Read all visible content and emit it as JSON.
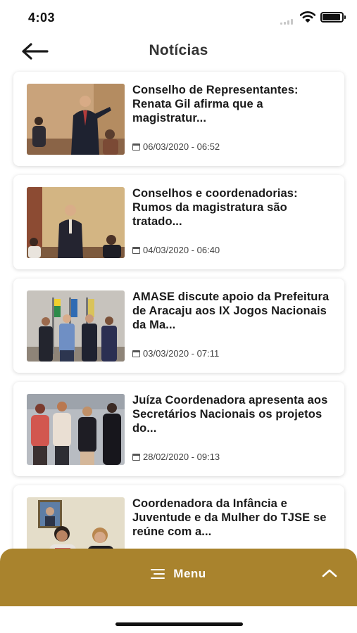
{
  "status_bar": {
    "time": "4:03"
  },
  "header": {
    "title": "Notícias",
    "back_icon": "arrow-left-icon"
  },
  "news": [
    {
      "title": "Conselho de Representantes: Renata Gil afirma que a magistratur...",
      "date": "06/03/2020 - 06:52"
    },
    {
      "title": "Conselhos e coordenadorias: Rumos da magistratura são tratado...",
      "date": "04/03/2020 - 06:40"
    },
    {
      "title": "AMASE  discute apoio da Prefeitura de Aracaju aos IX Jogos Nacionais da Ma...",
      "date": "03/03/2020 - 07:11"
    },
    {
      "title": "Juíza Coordenadora apresenta aos Secretários Nacionais os projetos do...",
      "date": "28/02/2020 - 09:13"
    },
    {
      "title": "Coordenadora da Infância e Juventude e da Mulher do TJSE se reúne com a...",
      "date": ""
    }
  ],
  "menu": {
    "label": "Menu",
    "icon": "hamburger-icon",
    "toggle_icon": "chevron-up-icon"
  },
  "colors": {
    "accent": "#a9832d",
    "background": "#ffffff"
  }
}
